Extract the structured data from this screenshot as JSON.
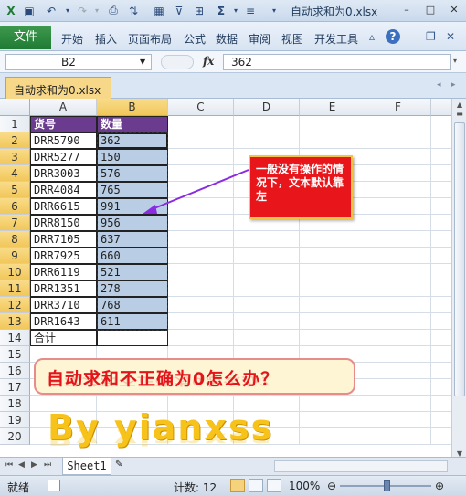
{
  "window": {
    "title": "自动求和为0.xlsx",
    "controls": [
      "–",
      "□",
      "✕"
    ]
  },
  "quick_access": {
    "icons": [
      "excel-icon",
      "save-icon",
      "undo-icon",
      "redo-icon",
      "print-preview-icon",
      "sort-icon",
      "number-format-icon",
      "filter-icon",
      "borders-icon",
      "autosum-icon",
      "align-icon",
      "customize-icon"
    ]
  },
  "ribbon": {
    "file": "文件",
    "tabs": [
      "开始",
      "插入",
      "页面布局",
      "公式",
      "数据",
      "审阅",
      "视图",
      "开发工具"
    ],
    "help": "?"
  },
  "formula_bar": {
    "name_box": "B2",
    "fx": "fx",
    "value": "362"
  },
  "workbook_tab": {
    "name": "自动求和为0.xlsx"
  },
  "columns": [
    "A",
    "B",
    "C",
    "D",
    "E",
    "F"
  ],
  "rows": [
    "1",
    "2",
    "3",
    "4",
    "5",
    "6",
    "7",
    "8",
    "9",
    "10",
    "11",
    "12",
    "13",
    "14",
    "15",
    "16",
    "17",
    "18",
    "19",
    "20"
  ],
  "table": {
    "header": {
      "a": "货号",
      "b": "数量"
    },
    "data": [
      {
        "a": "DRR5790",
        "b": "362"
      },
      {
        "a": "DRR5277",
        "b": "150"
      },
      {
        "a": "DRR3003",
        "b": "576"
      },
      {
        "a": "DRR4084",
        "b": "765"
      },
      {
        "a": "DRR6615",
        "b": "991"
      },
      {
        "a": "DRR8150",
        "b": "956"
      },
      {
        "a": "DRR7105",
        "b": "637"
      },
      {
        "a": "DRR7925",
        "b": "660"
      },
      {
        "a": "DRR6119",
        "b": "521"
      },
      {
        "a": "DRR1351",
        "b": "278"
      },
      {
        "a": "DRR3710",
        "b": "768"
      },
      {
        "a": "DRR1643",
        "b": "611"
      }
    ],
    "total_label": "合计"
  },
  "callout": {
    "text": "一般没有操作的情况下，文本默认靠左"
  },
  "banner": {
    "text": "自动求和不正确为0怎么办？"
  },
  "byline": {
    "text": "By  yianxss"
  },
  "sheet_tabs": {
    "active": "Sheet1"
  },
  "status": {
    "ready": "就绪",
    "count_label": "计数: 12",
    "zoom": "100%"
  },
  "colors": {
    "header_fill": "#6b3b8f",
    "value_fill": "#b9cde4",
    "callout_fill": "#e8161b",
    "banner_text": "#e4141b",
    "byline_text": "#f7c31b",
    "file_tab": "#2f8a41"
  }
}
